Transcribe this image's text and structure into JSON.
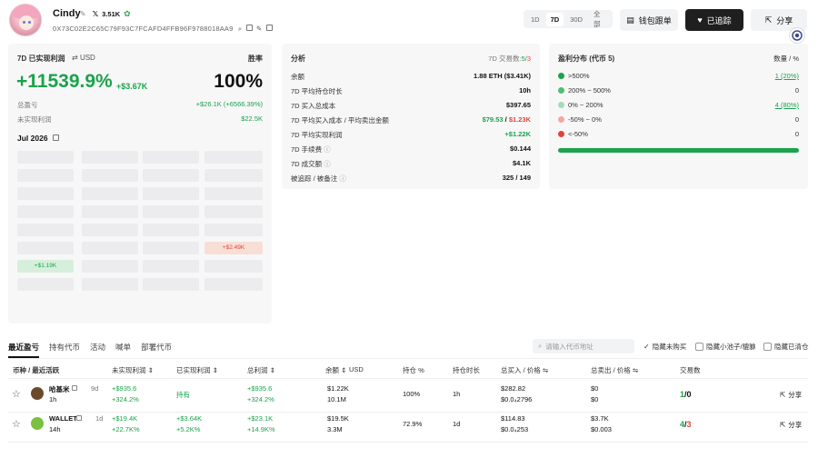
{
  "profile": {
    "name": "Cindy",
    "x_followers": "3.51K",
    "address": "0X73C02E2C65C79F93C7FCAFD4FFB96F9788018AA9"
  },
  "period_tabs": [
    "1D",
    "7D",
    "30D",
    "全部"
  ],
  "period_active": "7D",
  "buttons": {
    "copy_trade": "钱包跟单",
    "followed": "已追踪",
    "share": "分享"
  },
  "pnl_card": {
    "title": "7D 已实现利润",
    "currency": "USD",
    "winrate_label": "胜率",
    "pct": "+11539.9%",
    "usd": "+$3.67K",
    "winrate": "100%",
    "total_profit_label": "总盈亏",
    "total_profit": "+$26.1K (+6566.39%)",
    "unrealized_label": "未实现利润",
    "unrealized": "$22.5K",
    "month": "Jul 2026",
    "cell_red": "+$2.49K",
    "cell_green": "+$1.19K"
  },
  "analysis": {
    "title": "分析",
    "tx_label": "7D 交易数:",
    "tx_buy": "5",
    "tx_sell": "3",
    "rows": [
      {
        "label": "余额",
        "value": "1.88 ETH ($3.41K)"
      },
      {
        "label": "7D 平均持仓时长",
        "value": "10h"
      },
      {
        "label": "7D 买入总成本",
        "value": "$397.65"
      },
      {
        "label": "7D 平均买入成本 / 平均卖出金额",
        "value": "$79.53 / $1.23K"
      },
      {
        "label": "7D 平均实现利润",
        "value": "+$1.22K"
      },
      {
        "label": "7D 手续费",
        "value": "$0.144"
      },
      {
        "label": "7D 成交额",
        "value": "$4.1K"
      },
      {
        "label": "被追踪 / 被备注",
        "value": "325 / 149"
      }
    ]
  },
  "distribution": {
    "title": "盈利分布 (代币 5)",
    "right_label": "数量 / %",
    "rows": [
      {
        "label": ">500%",
        "value": "1 (20%)",
        "color": "#1aa34a"
      },
      {
        "label": "200% ~ 500%",
        "value": "0",
        "color": "#4fbf6e"
      },
      {
        "label": "0% ~ 200%",
        "value": "4 (80%)",
        "color": "#a7dcb5"
      },
      {
        "label": "-50% ~ 0%",
        "value": "0",
        "color": "#f3a7a2"
      },
      {
        "label": "<-50%",
        "value": "0",
        "color": "#e0453a"
      }
    ],
    "green_fraction": 1.0
  },
  "tabs": [
    "最近盈亏",
    "持有代币",
    "活动",
    "喊单",
    "部署代币"
  ],
  "tab_active": "最近盈亏",
  "search_placeholder": "请输入代币地址",
  "filters": [
    {
      "label": "隐藏未购买",
      "checked": true
    },
    {
      "label": "隐藏小池子/貔貅",
      "checked": false
    },
    {
      "label": "隐藏已清仓",
      "checked": false
    }
  ],
  "table": {
    "headers": [
      "币种 / 最近活跃",
      "未实现利润",
      "已实现利润",
      "总利润",
      "余额",
      "USD",
      "持仓 %",
      "持仓时长",
      "总买入 / 价格",
      "总卖出 / 价格",
      "交易数"
    ],
    "rows": [
      {
        "name": "哈基米",
        "age": "9d",
        "active": "1h",
        "unreal": "+$935.6",
        "unreal_pct": "+324.2%",
        "realized": "持有",
        "realized_pct": "",
        "total": "+$935.6",
        "total_pct": "+324.2%",
        "bal_usd": "$1.22K",
        "bal_amt": "10.1M",
        "hold_pct": "100%",
        "hold_time": "1h",
        "buy": "$282.82",
        "buy_price": "$0.0₄2796",
        "sell": "$0",
        "sell_price": "$0",
        "tx_buy": "1",
        "tx_sell": "0",
        "share": "分享",
        "coin_color": "#6b4a2a"
      },
      {
        "name": "WALLET",
        "age": "1d",
        "active": "14h",
        "unreal": "+$19.4K",
        "unreal_pct": "+22.7K%",
        "realized": "+$3.64K",
        "realized_pct": "+5.2K%",
        "total": "+$23.1K",
        "total_pct": "+14.9K%",
        "bal_usd": "$19.5K",
        "bal_amt": "3.3M",
        "hold_pct": "72.9%",
        "hold_time": "1d",
        "buy": "$114.83",
        "buy_price": "$0.0₄253",
        "sell": "$3.7K",
        "sell_price": "$0.003",
        "tx_buy": "4",
        "tx_sell": "3",
        "share": "分享",
        "coin_color": "#7bc043"
      }
    ]
  }
}
